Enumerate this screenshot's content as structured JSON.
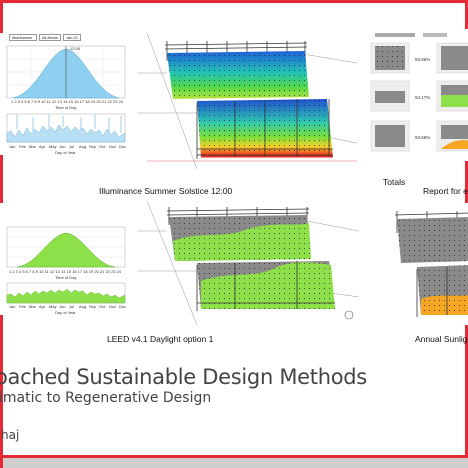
{
  "slide": {
    "title": "oached Sustainable Design Methods",
    "subtitle": "imatic to Regenerative Design",
    "author": "haj"
  },
  "top_chart": {
    "controls": [
      "Illuminance",
      "All Areas",
      "Jan 21"
    ],
    "time_label": "12:00",
    "xlabel": "Time of Day",
    "xlabel2": "Day of Year",
    "months": [
      "Jan",
      "Feb",
      "Mar",
      "Apr",
      "May",
      "Jun",
      "Jul",
      "Aug",
      "Sep",
      "Oct",
      "Nov",
      "Dec"
    ]
  },
  "bottom_chart": {
    "xlabel": "Time of Day",
    "xlabel2": "Day of Year",
    "months": [
      "Jan",
      "Feb",
      "Mar",
      "Apr",
      "May",
      "Jun",
      "Jul",
      "Aug",
      "Sep",
      "Oct",
      "Nov",
      "Dec"
    ]
  },
  "captions": {
    "summer": "Illuminance Summer Solstice 12:00",
    "totals": "Totals",
    "report": "Report for ea",
    "leed": "LEED v4.1 Daylight option 1",
    "annual": "Annual Sunlight"
  },
  "report": {
    "percentages": [
      "93.86%",
      "94.17%",
      "93.68%"
    ]
  },
  "colors": {
    "frame": "#e52a33",
    "sky_blue": "#8fd0f0",
    "green": "#8ee04a",
    "orange": "#f5a623"
  }
}
